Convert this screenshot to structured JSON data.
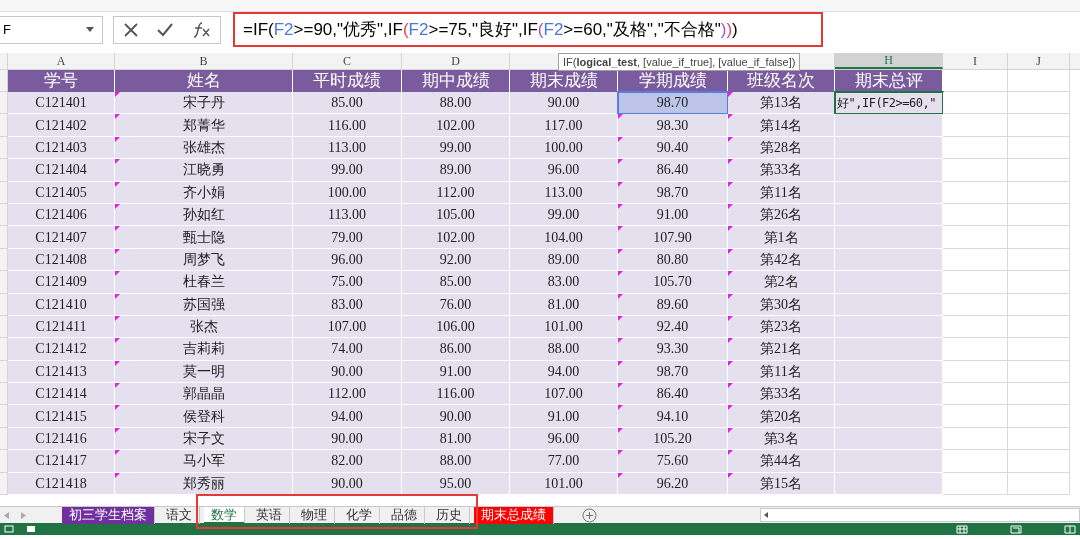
{
  "name_box": "F",
  "formula_bar": {
    "outlined": true,
    "segments": [
      {
        "text": "=IF(",
        "color": "#000000"
      },
      {
        "text": "F2",
        "color": "#4a78d8"
      },
      {
        "text": ">=90,\"优秀\",IF",
        "color": "#000000"
      },
      {
        "text": "(",
        "color": "#e0465a"
      },
      {
        "text": "F2",
        "color": "#4a78d8"
      },
      {
        "text": ">=75,\"良好\",IF",
        "color": "#000000"
      },
      {
        "text": "(",
        "color": "#9b59b6"
      },
      {
        "text": "F2",
        "color": "#4a78d8"
      },
      {
        "text": ">=60,\"及格\",\"不合格\"",
        "color": "#000000"
      },
      {
        "text": ")",
        "color": "#9b59b6"
      },
      {
        "text": ")",
        "color": "#e0465a"
      },
      {
        "text": ")",
        "color": "#000000"
      }
    ]
  },
  "tooltip": "IF(**logical_test**, [value_if_true], [value_if_false])",
  "columns": [
    {
      "letter": "A",
      "selected": false
    },
    {
      "letter": "B",
      "selected": false
    },
    {
      "letter": "C",
      "selected": false
    },
    {
      "letter": "D",
      "selected": false
    },
    {},
    {},
    {},
    {
      "letter": "H",
      "selected": true
    },
    {
      "letter": "I",
      "selected": false
    },
    {
      "letter": "J",
      "selected": false
    }
  ],
  "header_row": [
    "学号",
    "姓名",
    "平时成绩",
    "期中成绩",
    "期末成绩",
    "学期成绩",
    "班级名次",
    "期末总评"
  ],
  "rows": [
    {
      "cells": [
        "C121401",
        "宋子丹",
        "85.00",
        "88.00",
        "90.00",
        {
          "text": "98.70",
          "selected": true
        },
        "第13名",
        {
          "text": "好\",IF(F2>=60,\"",
          "editing": true
        }
      ]
    },
    {
      "cells": [
        "C121402",
        "郑菁华",
        "116.00",
        "102.00",
        "117.00",
        "98.30",
        "第14名"
      ]
    },
    {
      "cells": [
        "C121403",
        "张雄杰",
        "113.00",
        "99.00",
        "100.00",
        "90.40",
        "第28名"
      ]
    },
    {
      "cells": [
        "C121404",
        "江晓勇",
        "99.00",
        "89.00",
        "96.00",
        "86.40",
        "第33名"
      ]
    },
    {
      "cells": [
        "C121405",
        "齐小娟",
        "100.00",
        "112.00",
        "113.00",
        "98.70",
        "第11名"
      ]
    },
    {
      "cells": [
        "C121406",
        "孙如红",
        "113.00",
        "105.00",
        "99.00",
        "91.00",
        "第26名"
      ]
    },
    {
      "cells": [
        "C121407",
        "甄士隐",
        "79.00",
        "102.00",
        "104.00",
        "107.90",
        "第1名"
      ]
    },
    {
      "cells": [
        "C121408",
        "周梦飞",
        "96.00",
        "92.00",
        "89.00",
        "80.80",
        "第42名"
      ]
    },
    {
      "cells": [
        "C121409",
        "杜春兰",
        "75.00",
        "85.00",
        "83.00",
        "105.70",
        "第2名"
      ]
    },
    {
      "cells": [
        "C121410",
        "苏国强",
        "83.00",
        "76.00",
        "81.00",
        "89.60",
        "第30名"
      ]
    },
    {
      "cells": [
        "C121411",
        "张杰",
        "107.00",
        "106.00",
        "101.00",
        "92.40",
        "第23名"
      ]
    },
    {
      "cells": [
        "C121412",
        "吉莉莉",
        "74.00",
        "86.00",
        "88.00",
        "93.30",
        "第21名"
      ]
    },
    {
      "cells": [
        "C121413",
        "莫一明",
        "90.00",
        "91.00",
        "94.00",
        "98.70",
        "第11名"
      ]
    },
    {
      "cells": [
        "C121414",
        "郭晶晶",
        "112.00",
        "116.00",
        "107.00",
        "86.40",
        "第33名"
      ]
    },
    {
      "cells": [
        "C121415",
        "侯登科",
        "94.00",
        "90.00",
        "91.00",
        "94.10",
        "第20名"
      ]
    },
    {
      "cells": [
        "C121416",
        "宋子文",
        "90.00",
        "81.00",
        "96.00",
        "105.20",
        "第3名"
      ]
    },
    {
      "cells": [
        "C121417",
        "马小军",
        "82.00",
        "88.00",
        "77.00",
        "75.60",
        "第44名"
      ]
    },
    {
      "cells": [
        "C121418",
        "郑秀丽",
        "90.00",
        "95.00",
        "101.00",
        "96.20",
        "第15名"
      ]
    }
  ],
  "sheet_tabs": [
    {
      "label": "初三学生档案",
      "selected": false,
      "color": "#7030a0"
    },
    {
      "label": "语文",
      "selected": false
    },
    {
      "kind": "group",
      "outlined": true,
      "tabs": [
        {
          "label": "数学",
          "selected": true
        },
        {
          "label": "英语",
          "selected": false
        },
        {
          "label": "物理",
          "selected": false
        },
        {
          "label": "化学",
          "selected": false
        },
        {
          "label": "品德",
          "selected": false
        },
        {
          "label": "历史",
          "selected": false
        }
      ]
    },
    {
      "label": "期末总成绩",
      "selected": false,
      "color": "#ff0000"
    }
  ]
}
